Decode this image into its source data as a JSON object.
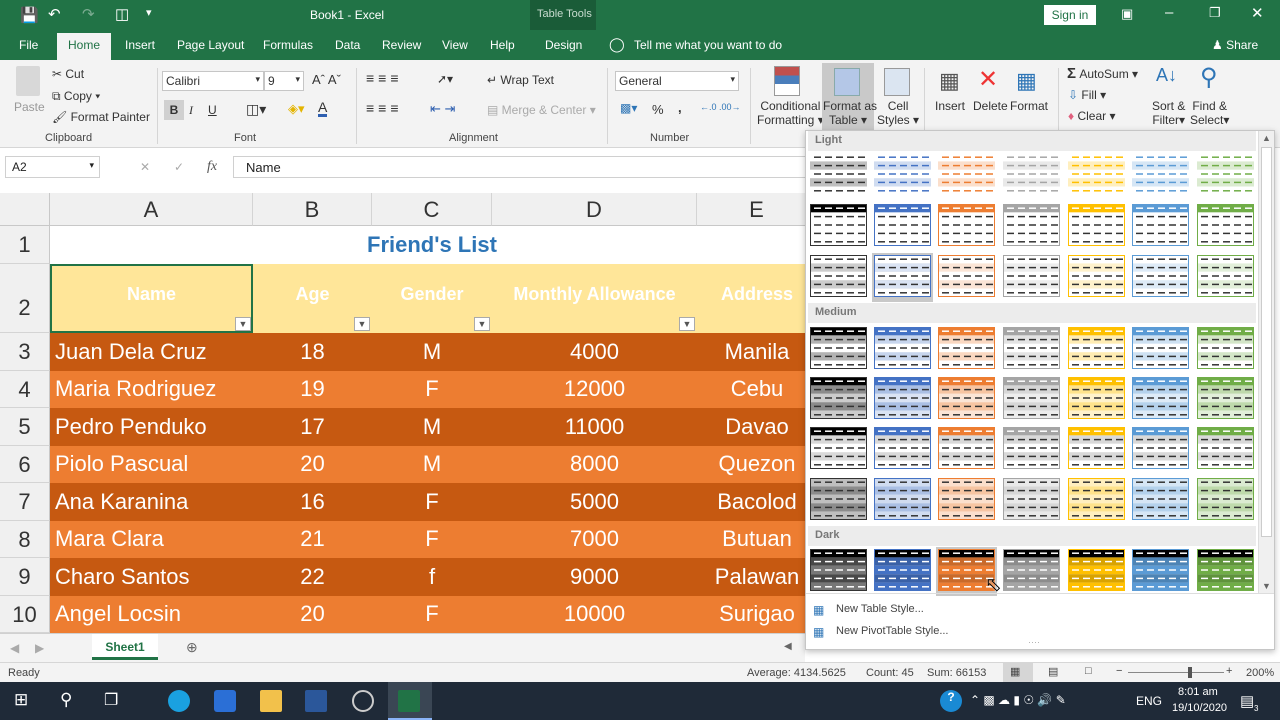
{
  "title": {
    "doc": "Book1  -  Excel",
    "contextual": "Table Tools",
    "sign_in": "Sign in"
  },
  "tabs": [
    "File",
    "Home",
    "Insert",
    "Page Layout",
    "Formulas",
    "Data",
    "Review",
    "View",
    "Help",
    "Design"
  ],
  "tell_me": "Tell me what you want to do",
  "share": "Share",
  "clipboard": {
    "paste": "Paste",
    "cut": "Cut",
    "copy": "Copy",
    "format_painter": "Format Painter",
    "label": "Clipboard"
  },
  "font": {
    "name": "Calibri",
    "size": "9",
    "label": "Font",
    "bold": "B",
    "italic": "I",
    "underline": "U"
  },
  "alignment": {
    "wrap": "Wrap Text",
    "merge": "Merge & Center",
    "label": "Alignment"
  },
  "number": {
    "format": "General",
    "percent": "%",
    "comma": ",",
    "label": "Number"
  },
  "styles": {
    "conditional": [
      "Conditional",
      "Formatting"
    ],
    "format_table": [
      "Format as",
      "Table"
    ],
    "cell_styles": [
      "Cell",
      "Styles"
    ]
  },
  "cells": {
    "insert": "Insert",
    "delete": "Delete",
    "format": "Format"
  },
  "editing": {
    "autosum": "AutoSum",
    "fill": "Fill",
    "clear": "Clear",
    "sort": [
      "Sort &",
      "Filter"
    ],
    "find": [
      "Find &",
      "Select"
    ]
  },
  "formula_bar": {
    "name_box": "A2",
    "fx": "fx",
    "value": "Name"
  },
  "columns": [
    "A",
    "B",
    "C",
    "D",
    "E"
  ],
  "rows": [
    "1",
    "2",
    "3",
    "4",
    "5",
    "6",
    "7",
    "8",
    "9",
    "10"
  ],
  "sheet_title": "Friend's List",
  "headers": [
    "Name",
    "Age",
    "Gender",
    "Monthly Allowance",
    "Address"
  ],
  "data": [
    [
      "Juan Dela Cruz",
      "18",
      "M",
      "4000",
      "Manila"
    ],
    [
      "Maria Rodriguez",
      "19",
      "F",
      "12000",
      "Cebu"
    ],
    [
      "Pedro Penduko",
      "17",
      "M",
      "11000",
      "Davao"
    ],
    [
      "Piolo Pascual",
      "20",
      "M",
      "8000",
      "Quezon"
    ],
    [
      "Ana Karanina",
      "16",
      "F",
      "5000",
      "Bacolod"
    ],
    [
      "Mara Clara",
      "21",
      "F",
      "7000",
      "Butuan"
    ],
    [
      "Charo Santos",
      "22",
      "f",
      "9000",
      "Palawan"
    ],
    [
      "Angel Locsin",
      "20",
      "F",
      "10000",
      "Surigao"
    ]
  ],
  "gallery": {
    "sections": [
      "Light",
      "Medium",
      "Dark"
    ],
    "new_table_style": "New Table Style...",
    "new_pivot_style": "New PivotTable Style...",
    "colors": [
      "#000000",
      "#4472c4",
      "#ed7d31",
      "#a5a5a5",
      "#ffc000",
      "#5b9bd5",
      "#70ad47"
    ]
  },
  "sheet_tab": "Sheet1",
  "status": {
    "ready": "Ready",
    "average": "Average: 4134.5625",
    "count": "Count: 45",
    "sum": "Sum: 66153",
    "zoom": "200%"
  },
  "taskbar": {
    "lang": "ENG",
    "time": "8:01 am",
    "date": "19/10/2020",
    "notifications": "3"
  },
  "theme": {
    "excel_green": "#217346",
    "dark_orange": "#c65911",
    "light_orange": "#ed7d31",
    "header_fill": "#ffe699",
    "title_blue": "#2e75b6"
  }
}
